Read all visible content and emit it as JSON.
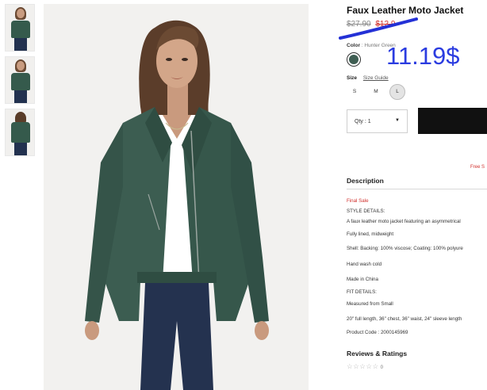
{
  "thumbnails": [
    {
      "label": "product-view-front"
    },
    {
      "label": "product-view-side"
    },
    {
      "label": "product-view-back"
    }
  ],
  "product": {
    "title": "Faux Leather Moto Jacket",
    "price_original": "$27.90",
    "price_sale": "$12.9",
    "annotation_price": "11.19$",
    "color_label": "Color",
    "color_value": "Hunter Green",
    "size_label": "Size",
    "size_guide": "Size Guide",
    "sizes": [
      "S",
      "M",
      "L"
    ],
    "selected_size": "L",
    "qty_label": "Qty : 1",
    "free_shipping": "Free S"
  },
  "description": {
    "heading": "Description",
    "final_sale": "Final Sale",
    "style_heading": "STYLE DETAILS:",
    "lines": [
      "A faux leather moto jacket featuring an asymmetrical",
      "Fully lined, midweight",
      "Shell: Backing: 100% viscose; Coating: 100% polyure",
      "Hand wash cold",
      "Made in China"
    ],
    "fit_heading": "FIT DETAILS:",
    "fit_lines": [
      "Measured from Small",
      "20\" full length, 36\" chest, 36\" waist, 24\" sleeve length"
    ],
    "product_code": "Product Code : 2000145969"
  },
  "reviews": {
    "heading": "Reviews & Ratings",
    "stars": "☆☆☆☆☆",
    "count": "0"
  },
  "colors": {
    "sale_red": "#d0312d",
    "annotation_blue": "#2b3ce0",
    "jacket_green": "#3e5d52",
    "button_black": "#111111"
  }
}
